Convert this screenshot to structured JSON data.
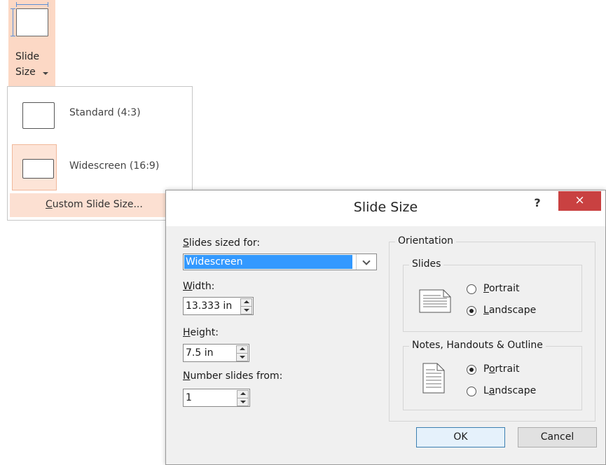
{
  "ribbon": {
    "button_line1": "Slide",
    "button_line2": "Size",
    "icon": "slide-size-icon"
  },
  "menu": {
    "items": [
      {
        "label": "Standard (4:3)",
        "icon": "standard-slide-icon"
      },
      {
        "label": "Widescreen (16:9)",
        "icon": "widescreen-slide-icon",
        "selected": true
      }
    ],
    "custom_accel": "C",
    "custom_rest": "ustom Slide Size..."
  },
  "dialog": {
    "title": "Slide Size",
    "help": "?",
    "close": "×",
    "slides_sized_for": {
      "accel": "S",
      "rest": "lides sized for:",
      "value": "Widescreen"
    },
    "width": {
      "accel": "W",
      "rest": "idth:",
      "value": "13.333 in"
    },
    "height": {
      "accel": "H",
      "rest": "eight:",
      "value": "7.5 in"
    },
    "number_from": {
      "accel": "N",
      "rest": "umber slides from:",
      "value": "1"
    },
    "orientation": {
      "label": "Orientation",
      "slides": {
        "label": "Slides",
        "portrait_accel": "P",
        "portrait_rest": "ortrait",
        "landscape_accel": "L",
        "landscape_rest": "andscape",
        "selected": "Landscape"
      },
      "notes": {
        "label": "Notes, Handouts & Outline",
        "portrait_pre": "P",
        "portrait_accel": "o",
        "portrait_rest": "rtrait",
        "landscape_pre": "L",
        "landscape_accel": "a",
        "landscape_rest": "ndscape",
        "selected": "Portrait"
      }
    },
    "ok": "OK",
    "cancel": "Cancel"
  },
  "colors": {
    "accent_selected": "#fcd8c5",
    "close_button": "#c94141",
    "combo_highlight": "#3399ff"
  }
}
